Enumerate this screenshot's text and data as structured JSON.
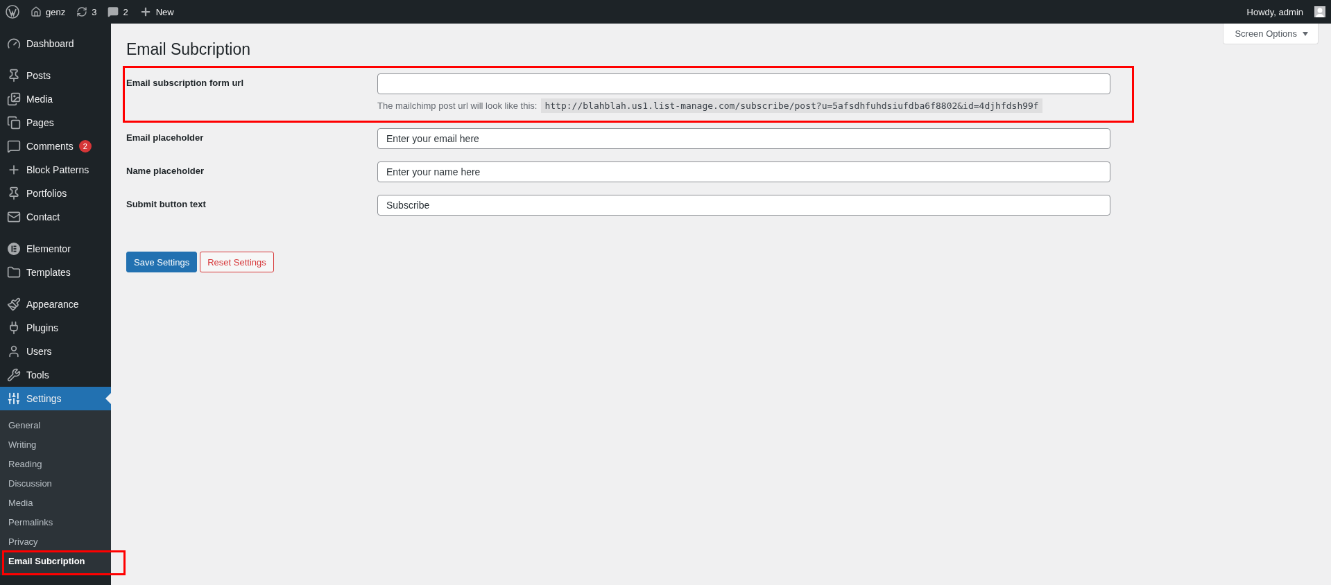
{
  "top_bar": {
    "site": "genz",
    "updates": "3",
    "comments": "2",
    "new_label": "New",
    "greeting": "Howdy, admin"
  },
  "sidebar": {
    "groups": [
      {
        "items": [
          {
            "label": "Dashboard",
            "selected": false
          }
        ]
      },
      {
        "items": [
          {
            "label": "Posts",
            "selected": false
          },
          {
            "label": "Media",
            "selected": false
          },
          {
            "label": "Pages",
            "selected": false
          },
          {
            "label": "Comments",
            "selected": false,
            "badge": "2"
          },
          {
            "label": "Block Patterns",
            "selected": false
          },
          {
            "label": "Portfolios",
            "selected": false
          },
          {
            "label": "Contact",
            "selected": false
          }
        ]
      },
      {
        "items": [
          {
            "label": "Elementor",
            "selected": false
          },
          {
            "label": "Templates",
            "selected": false
          }
        ]
      },
      {
        "items": [
          {
            "label": "Appearance",
            "selected": false
          },
          {
            "label": "Plugins",
            "selected": false
          },
          {
            "label": "Users",
            "selected": false
          },
          {
            "label": "Tools",
            "selected": false
          },
          {
            "label": "Settings",
            "selected": true,
            "children": [
              {
                "label": "General",
                "selected": false,
                "highlighted": false
              },
              {
                "label": "Writing",
                "selected": false,
                "highlighted": false
              },
              {
                "label": "Reading",
                "selected": false,
                "highlighted": false
              },
              {
                "label": "Discussion",
                "selected": false,
                "highlighted": false
              },
              {
                "label": "Media",
                "selected": false,
                "highlighted": false
              },
              {
                "label": "Permalinks",
                "selected": false,
                "highlighted": false
              },
              {
                "label": "Privacy",
                "selected": false,
                "highlighted": false
              },
              {
                "label": "Email Subcription",
                "selected": true,
                "highlighted": true
              }
            ]
          }
        ]
      }
    ]
  },
  "screen_options": {
    "label": "Screen Options"
  },
  "page": {
    "title": "Email Subcription"
  },
  "fields": [
    {
      "label": "Email subscription form url",
      "hint": "The mailchimp post url will look like this:",
      "hint_code": "http://blahblah.us1.list-manage.com/subscribe/post?u=5afsdhfuhdsiufdba6f8802&id=4djhfdsh99f",
      "highlighted": true
    },
    {
      "label": "Email placeholder",
      "value": "Enter your email here",
      "highlighted": false
    },
    {
      "label": "Name placeholder",
      "value": "Enter your name here",
      "highlighted": false
    },
    {
      "label": "Submit button text",
      "value": "Subscribe",
      "highlighted": false
    }
  ],
  "buttons": [
    {
      "label": "Save Settings",
      "kind": "primary"
    },
    {
      "label": "Reset Settings",
      "kind": "danger"
    }
  ]
}
